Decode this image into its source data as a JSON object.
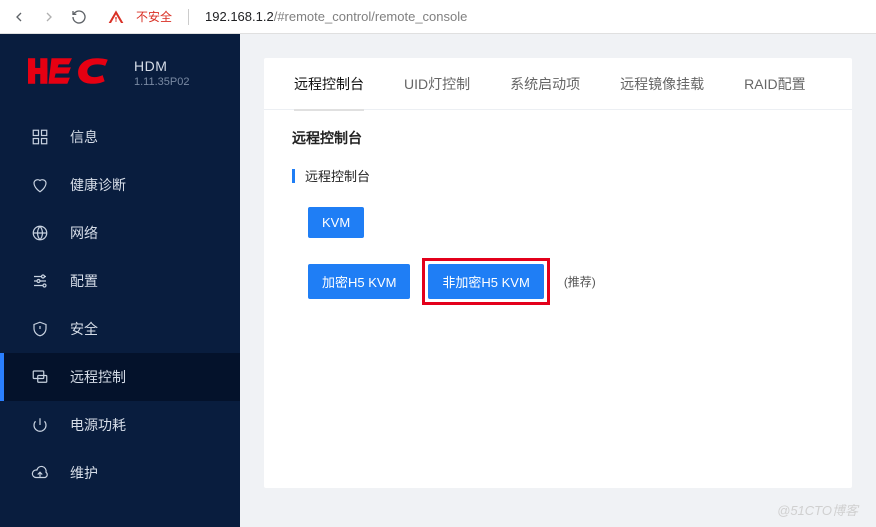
{
  "browser": {
    "not_secure": "不安全",
    "url_host": "192.168.1.2",
    "url_path": "/#remote_control/remote_console"
  },
  "brand": {
    "title": "HDM",
    "version": "1.11.35P02"
  },
  "sidebar": {
    "items": [
      {
        "label": "信息"
      },
      {
        "label": "健康诊断"
      },
      {
        "label": "网络"
      },
      {
        "label": "配置"
      },
      {
        "label": "安全"
      },
      {
        "label": "远程控制"
      },
      {
        "label": "电源功耗"
      },
      {
        "label": "维护"
      }
    ]
  },
  "tabs": [
    {
      "label": "远程控制台"
    },
    {
      "label": "UID灯控制"
    },
    {
      "label": "系统启动项"
    },
    {
      "label": "远程镜像挂载"
    },
    {
      "label": "RAID配置"
    }
  ],
  "section": {
    "title": "远程控制台",
    "sub": "远程控制台"
  },
  "buttons": {
    "kvm": "KVM",
    "enc_h5": "加密H5 KVM",
    "noenc_h5": "非加密H5 KVM",
    "note": "(推荐)"
  },
  "watermark": "@51CTO博客"
}
